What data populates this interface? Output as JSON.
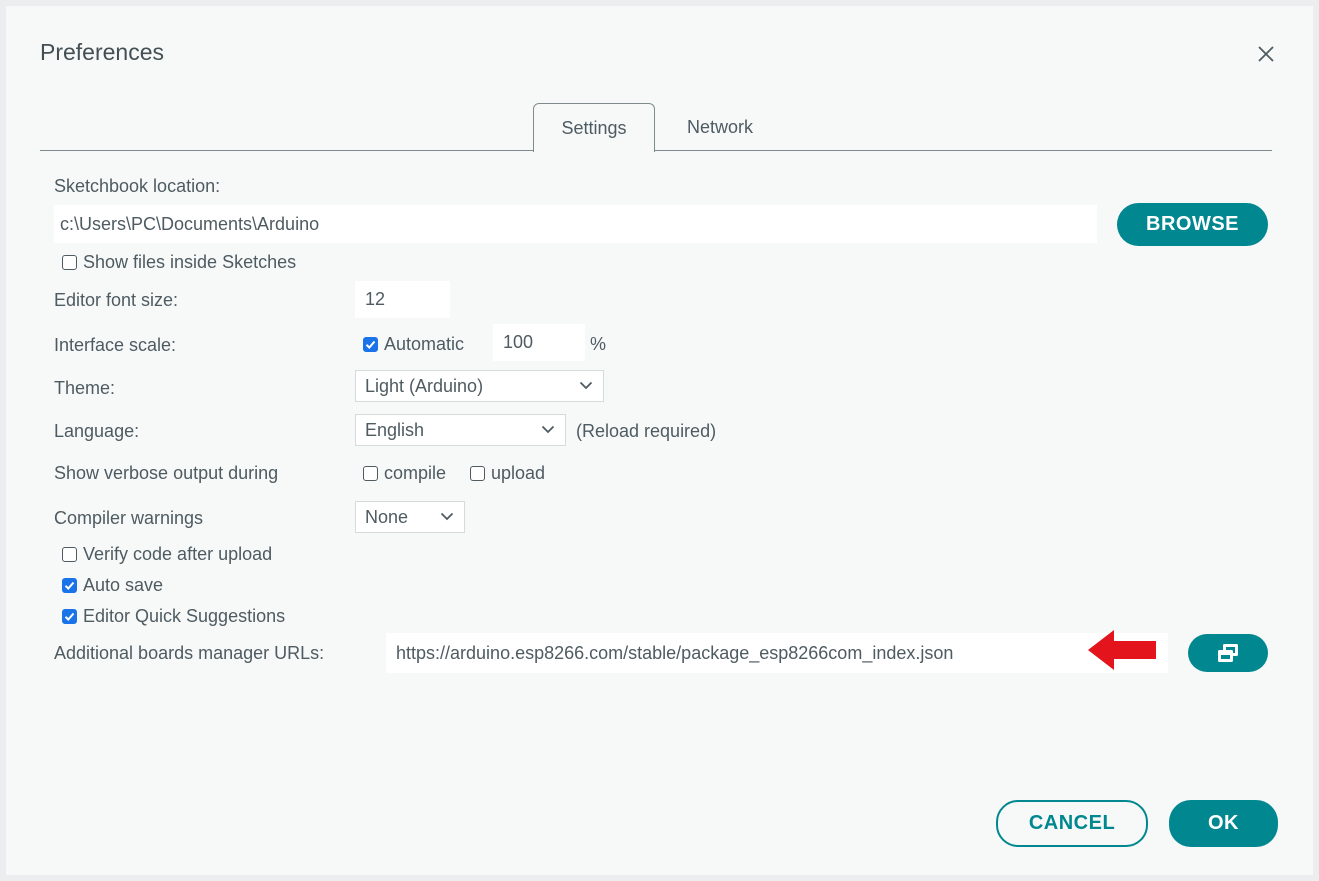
{
  "dialog": {
    "title": "Preferences",
    "tabs": [
      {
        "label": "Settings",
        "active": true
      },
      {
        "label": "Network",
        "active": false
      }
    ]
  },
  "settings": {
    "sketchbook_label": "Sketchbook location:",
    "sketchbook_path": "c:\\Users\\PC\\Documents\\Arduino",
    "browse_label": "BROWSE",
    "show_files_label": "Show files inside Sketches",
    "show_files_checked": false,
    "font_size_label": "Editor font size:",
    "font_size_value": "12",
    "scale_label": "Interface scale:",
    "scale_auto_label": "Automatic",
    "scale_auto_checked": true,
    "scale_value": "100",
    "scale_unit": "%",
    "theme_label": "Theme:",
    "theme_value": "Light (Arduino)",
    "language_label": "Language:",
    "language_value": "English",
    "language_note": "(Reload required)",
    "verbose_label": "Show verbose output during",
    "verbose_compile_label": "compile",
    "verbose_compile_checked": false,
    "verbose_upload_label": "upload",
    "verbose_upload_checked": false,
    "warnings_label": "Compiler warnings",
    "warnings_value": "None",
    "verify_label": "Verify code after upload",
    "verify_checked": false,
    "autosave_label": "Auto save",
    "autosave_checked": true,
    "quick_suggestions_label": "Editor Quick Suggestions",
    "quick_suggestions_checked": true,
    "boards_urls_label": "Additional boards manager URLs:",
    "boards_urls_value": "https://arduino.esp8266.com/stable/package_esp8266com_index.json"
  },
  "footer": {
    "cancel_label": "CANCEL",
    "ok_label": "OK"
  },
  "colors": {
    "accent": "#00878f",
    "checkbox_checked": "#1a73e8",
    "annotation_arrow": "#e3141b",
    "text": "#4e5b61"
  },
  "icons": {
    "close": "close-icon",
    "open_editor": "open-window-icon",
    "chevron": "chevron-down-icon",
    "annotation": "red-arrow-icon"
  }
}
